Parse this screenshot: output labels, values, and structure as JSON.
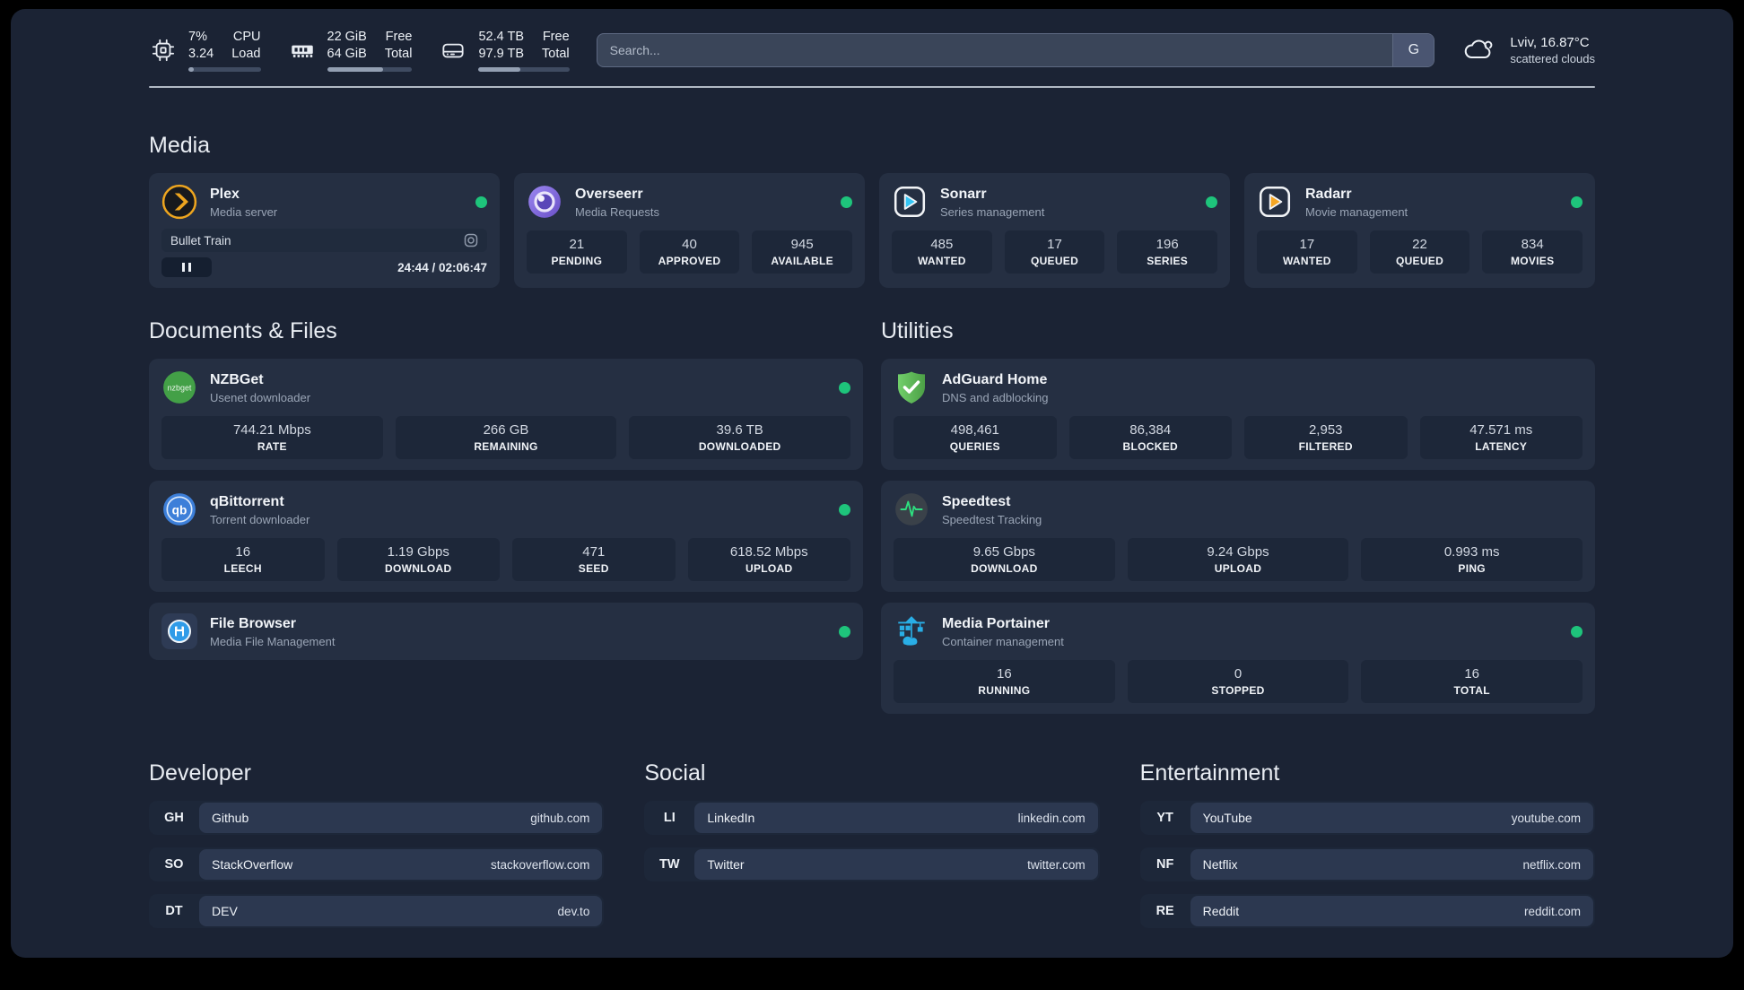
{
  "header": {
    "stats": [
      {
        "icon": "cpu-icon",
        "top_value": "7%",
        "bottom_value": "3.24",
        "top_label": "CPU",
        "bottom_label": "Load",
        "percent": 7
      },
      {
        "icon": "ram-icon",
        "top_value": "22 GiB",
        "bottom_value": "64 GiB",
        "top_label": "Free",
        "bottom_label": "Total",
        "percent": 66
      },
      {
        "icon": "disk-icon",
        "top_value": "52.4 TB",
        "bottom_value": "97.9 TB",
        "top_label": "Free",
        "bottom_label": "Total",
        "percent": 46
      }
    ],
    "search": {
      "placeholder": "Search...",
      "button_label": "G"
    },
    "weather": {
      "location_temp": "Lviv, 16.87°C",
      "condition": "scattered clouds"
    }
  },
  "media": {
    "heading": "Media",
    "plex": {
      "title": "Plex",
      "subtitle": "Media server",
      "online": true,
      "now_playing": "Bullet Train",
      "time": "24:44 / 02:06:47"
    },
    "overseerr": {
      "title": "Overseerr",
      "subtitle": "Media Requests",
      "online": true,
      "stats": [
        {
          "value": "21",
          "label": "PENDING"
        },
        {
          "value": "40",
          "label": "APPROVED"
        },
        {
          "value": "945",
          "label": "AVAILABLE"
        }
      ]
    },
    "sonarr": {
      "title": "Sonarr",
      "subtitle": "Series management",
      "online": true,
      "stats": [
        {
          "value": "485",
          "label": "WANTED"
        },
        {
          "value": "17",
          "label": "QUEUED"
        },
        {
          "value": "196",
          "label": "SERIES"
        }
      ]
    },
    "radarr": {
      "title": "Radarr",
      "subtitle": "Movie management",
      "online": true,
      "stats": [
        {
          "value": "17",
          "label": "WANTED"
        },
        {
          "value": "22",
          "label": "QUEUED"
        },
        {
          "value": "834",
          "label": "MOVIES"
        }
      ]
    }
  },
  "documents": {
    "heading": "Documents & Files",
    "nzbget": {
      "title": "NZBGet",
      "subtitle": "Usenet downloader",
      "online": true,
      "icon_text": "nzbget",
      "stats": [
        {
          "value": "744.21 Mbps",
          "label": "RATE"
        },
        {
          "value": "266 GB",
          "label": "REMAINING"
        },
        {
          "value": "39.6 TB",
          "label": "DOWNLOADED"
        }
      ]
    },
    "qbittorrent": {
      "title": "qBittorrent",
      "subtitle": "Torrent downloader",
      "online": true,
      "icon_text": "qb",
      "stats": [
        {
          "value": "16",
          "label": "LEECH"
        },
        {
          "value": "1.19 Gbps",
          "label": "DOWNLOAD"
        },
        {
          "value": "471",
          "label": "SEED"
        },
        {
          "value": "618.52 Mbps",
          "label": "UPLOAD"
        }
      ]
    },
    "filebrowser": {
      "title": "File Browser",
      "subtitle": "Media File Management",
      "online": true
    }
  },
  "utilities": {
    "heading": "Utilities",
    "adguard": {
      "title": "AdGuard Home",
      "subtitle": "DNS and adblocking",
      "online": false,
      "stats": [
        {
          "value": "498,461",
          "label": "QUERIES"
        },
        {
          "value": "86,384",
          "label": "BLOCKED"
        },
        {
          "value": "2,953",
          "label": "FILTERED"
        },
        {
          "value": "47.571 ms",
          "label": "LATENCY"
        }
      ]
    },
    "speedtest": {
      "title": "Speedtest",
      "subtitle": "Speedtest Tracking",
      "online": false,
      "stats": [
        {
          "value": "9.65 Gbps",
          "label": "DOWNLOAD"
        },
        {
          "value": "9.24 Gbps",
          "label": "UPLOAD"
        },
        {
          "value": "0.993 ms",
          "label": "PING"
        }
      ]
    },
    "portainer": {
      "title": "Media Portainer",
      "subtitle": "Container management",
      "online": true,
      "stats": [
        {
          "value": "16",
          "label": "RUNNING"
        },
        {
          "value": "0",
          "label": "STOPPED"
        },
        {
          "value": "16",
          "label": "TOTAL"
        }
      ]
    }
  },
  "bookmarks": {
    "developer": {
      "heading": "Developer",
      "links": [
        {
          "abbr": "GH",
          "name": "Github",
          "url": "github.com"
        },
        {
          "abbr": "SO",
          "name": "StackOverflow",
          "url": "stackoverflow.com"
        },
        {
          "abbr": "DT",
          "name": "DEV",
          "url": "dev.to"
        }
      ]
    },
    "social": {
      "heading": "Social",
      "links": [
        {
          "abbr": "LI",
          "name": "LinkedIn",
          "url": "linkedin.com"
        },
        {
          "abbr": "TW",
          "name": "Twitter",
          "url": "twitter.com"
        }
      ]
    },
    "entertainment": {
      "heading": "Entertainment",
      "links": [
        {
          "abbr": "YT",
          "name": "YouTube",
          "url": "youtube.com"
        },
        {
          "abbr": "NF",
          "name": "Netflix",
          "url": "netflix.com"
        },
        {
          "abbr": "RE",
          "name": "Reddit",
          "url": "reddit.com"
        }
      ]
    }
  },
  "colors": {
    "status_online": "#1ec47b",
    "accent_blue": "#29aee6",
    "plex_amber": "#eda51f"
  }
}
